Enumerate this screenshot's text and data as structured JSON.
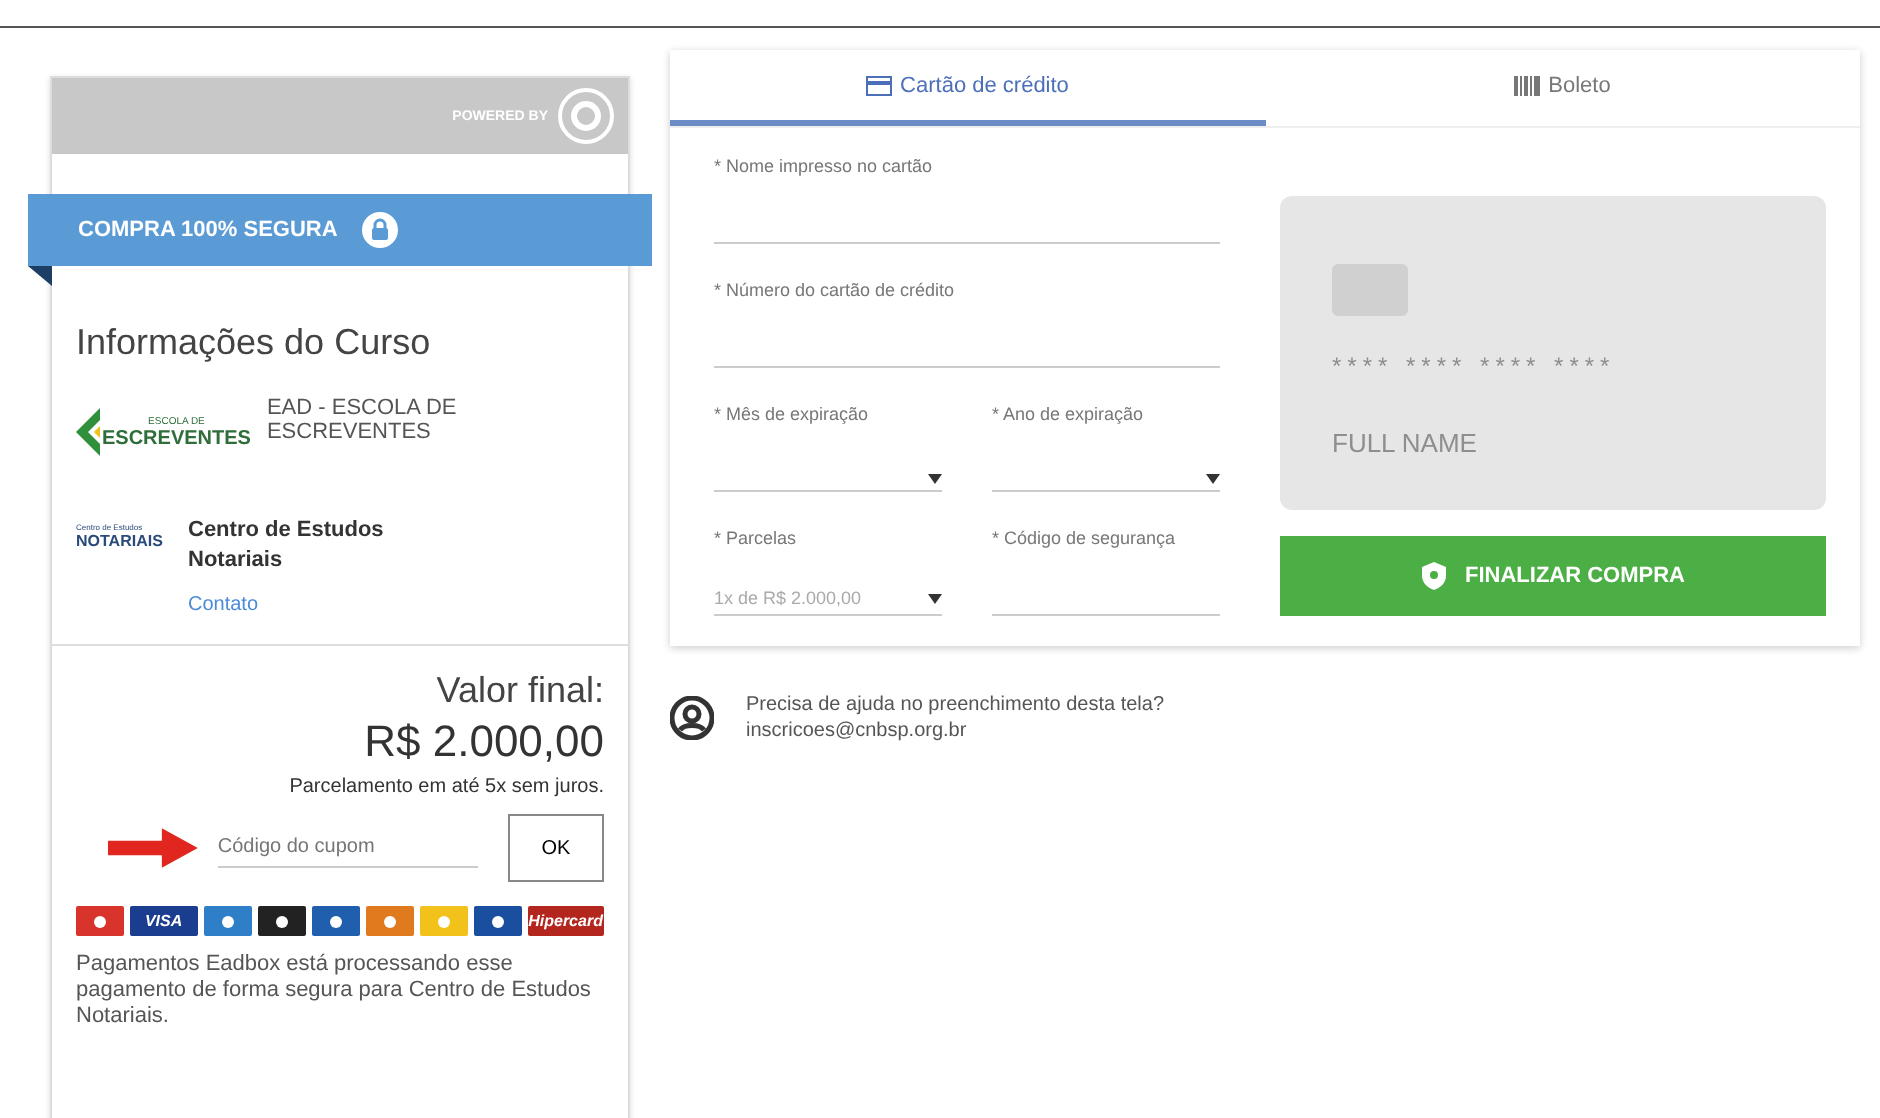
{
  "sidebar": {
    "powered_by": "POWERED BY",
    "banner": "COMPRA 100% SEGURA",
    "section_title": "Informações do Curso",
    "course": {
      "logo_top": "ESCOLA DE",
      "logo_main": "ESCREVENTES",
      "name": "EAD - ESCOLA DE ESCREVENTES"
    },
    "provider": {
      "logo_top": "Centro de Estudos",
      "logo_main": "NOTARIAIS",
      "name": "Centro de Estudos Notariais",
      "link": "Contato"
    },
    "total_label": "Valor final:",
    "total": "R$ 2.000,00",
    "installments_note": "Parcelamento em até 5x sem juros.",
    "coupon": {
      "placeholder": "Código do cupom",
      "button": "OK"
    },
    "card_brands": [
      {
        "color": "#d9342b"
      },
      {
        "color": "#1a3d8f",
        "label": "VISA"
      },
      {
        "color": "#2f7fc8"
      },
      {
        "color": "#222222"
      },
      {
        "color": "#1f5fae"
      },
      {
        "color": "#e07a1f"
      },
      {
        "color": "#f2c21a"
      },
      {
        "color": "#1a4fa0"
      },
      {
        "color": "#b3261e",
        "label": "Hipercard"
      }
    ],
    "footer_text": "Pagamentos Eadbox está processando esse pagamento de forma segura para Centro de Estudos Notariais."
  },
  "tabs": [
    {
      "label": "Cartão de crédito",
      "kind": "card",
      "selected": true
    },
    {
      "label": "Boleto",
      "kind": "barcode",
      "selected": false
    }
  ],
  "form": {
    "fields": [
      {
        "label": "* Nome impresso no cartão",
        "kind": "text"
      },
      {
        "label": "* Número do cartão de crédito",
        "kind": "text"
      },
      {
        "label": "* Mês de expiração",
        "kind": "select"
      },
      {
        "label": "* Ano de expiração",
        "kind": "select"
      },
      {
        "label": "* Parcelas",
        "kind": "select",
        "value": "1x de R$ 2.000,00"
      },
      {
        "label": "* Código de segurança",
        "kind": "text"
      }
    ]
  },
  "card_preview": {
    "number": "**** **** **** ****",
    "name": "FULL NAME"
  },
  "submit": "FINALIZAR COMPRA",
  "help": {
    "question": "Precisa de ajuda no preenchimento desta tela?",
    "email": "inscricoes@cnbsp.org.br"
  }
}
